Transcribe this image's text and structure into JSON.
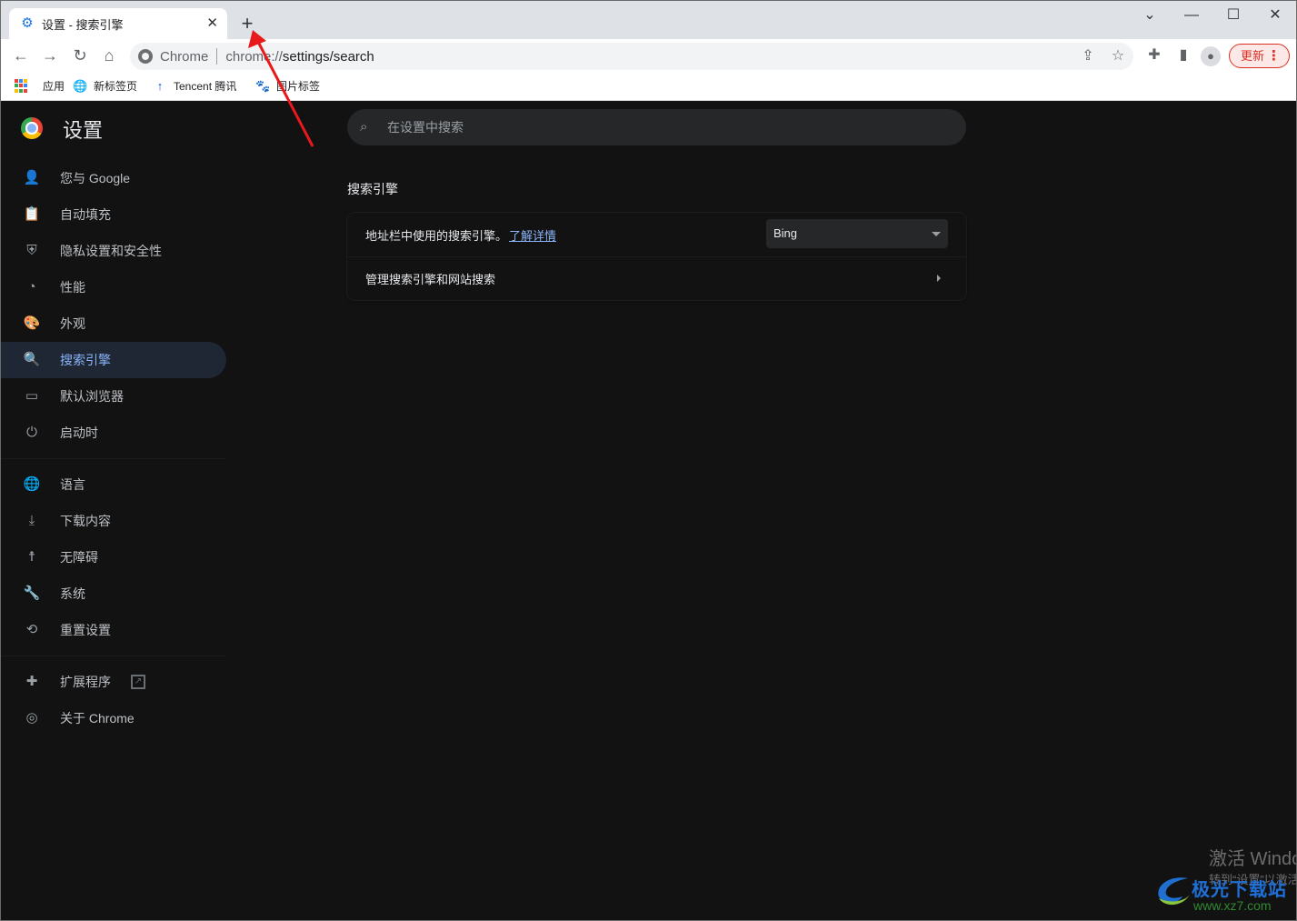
{
  "browser": {
    "tab": {
      "icon": "gear-icon",
      "title": "设置 - 搜索引擎",
      "close_icon": "close-icon"
    },
    "new_tab_icon": "plus-icon",
    "window_controls": {
      "tab_search": "chevron-down-icon",
      "minimize": "minimize-icon",
      "maximize": "maximize-icon",
      "close": "close-icon"
    },
    "nav": {
      "back": "back-arrow-icon",
      "forward": "forward-arrow-icon",
      "reload": "reload-icon",
      "home": "home-icon"
    },
    "omnibox": {
      "chip": "Chrome",
      "url_prefix": "chrome://",
      "url_rest": "settings/search"
    },
    "omnibox_icons": {
      "share": "share-icon",
      "bookmark": "star-icon"
    },
    "toolbar_icons": {
      "extensions": "puzzle-icon",
      "side_panel": "side-panel-icon",
      "profile": "profile-icon"
    },
    "update_button": {
      "label": "更新",
      "menu": "⋮"
    },
    "bookmarks": [
      {
        "label": "应用",
        "icon": "apps-grid-icon"
      },
      {
        "label": "新标签页",
        "icon": "globe-icon"
      },
      {
        "label": "Tencent 腾讯",
        "icon": "tencent-icon"
      },
      {
        "label": "图片标签",
        "icon": "paw-icon"
      }
    ]
  },
  "settings": {
    "title": "设置",
    "search_placeholder": "在设置中搜索",
    "nav_groups": [
      [
        {
          "label": "您与 Google",
          "icon": "person-icon",
          "glyph": "👤"
        },
        {
          "label": "自动填充",
          "icon": "clipboard-icon",
          "glyph": "📋"
        },
        {
          "label": "隐私设置和安全性",
          "icon": "shield-icon",
          "glyph": "⛨"
        },
        {
          "label": "性能",
          "icon": "speedometer-icon",
          "glyph": "◔"
        },
        {
          "label": "外观",
          "icon": "palette-icon",
          "glyph": "🎨"
        },
        {
          "label": "搜索引擎",
          "icon": "search-icon",
          "glyph": "🔍",
          "active": true
        },
        {
          "label": "默认浏览器",
          "icon": "browser-window-icon",
          "glyph": "▭"
        },
        {
          "label": "启动时",
          "icon": "power-icon",
          "glyph": "⏻"
        }
      ],
      [
        {
          "label": "语言",
          "icon": "globe-icon",
          "glyph": "🌐"
        },
        {
          "label": "下载内容",
          "icon": "download-icon",
          "glyph": "⤓"
        },
        {
          "label": "无障碍",
          "icon": "accessibility-icon",
          "glyph": "☨"
        },
        {
          "label": "系统",
          "icon": "wrench-icon",
          "glyph": "🔧"
        },
        {
          "label": "重置设置",
          "icon": "history-icon",
          "glyph": "⟲"
        }
      ],
      [
        {
          "label": "扩展程序",
          "icon": "puzzle-icon",
          "glyph": "✚",
          "external": true
        },
        {
          "label": "关于 Chrome",
          "icon": "chrome-icon",
          "glyph": "◎"
        }
      ]
    ],
    "section_title": "搜索引擎",
    "rows": {
      "default_engine_label": "地址栏中使用的搜索引擎。",
      "learn_more": "了解详情",
      "default_engine_value": "Bing",
      "manage_label": "管理搜索引擎和网站搜索"
    }
  },
  "overlay": {
    "activation_line1": "激活 Windows",
    "activation_line2": "转到“设置”以激活 Windows。",
    "watermark_name": "极光下载站",
    "watermark_url": "www.xz7.com",
    "annotation_arrow_color": "#e8191b"
  }
}
